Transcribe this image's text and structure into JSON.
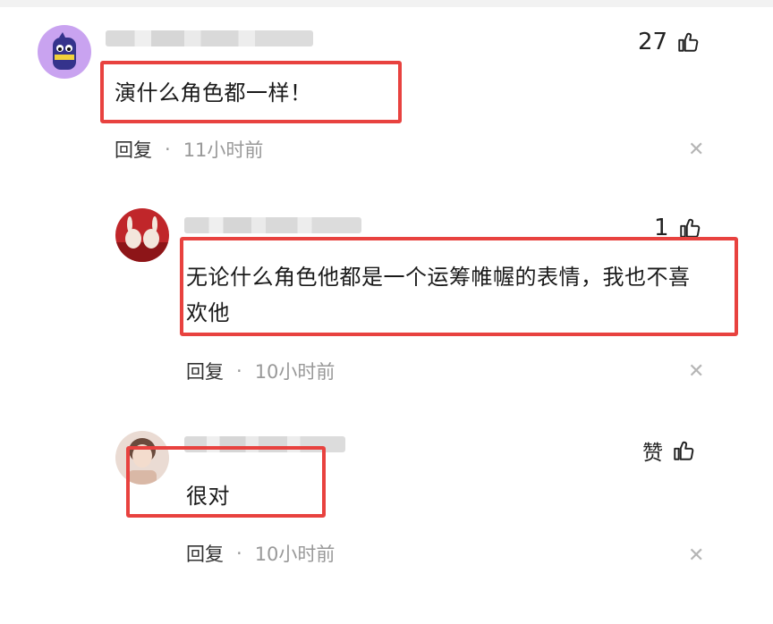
{
  "comments": [
    {
      "likes": "27",
      "text": "演什么角色都一样！",
      "reply_label": "回复",
      "separator": "·",
      "time": "11小时前"
    },
    {
      "likes": "1",
      "text": "无论什么角色他都是一个运筹帷幄的表情，我也不喜欢他",
      "reply_label": "回复",
      "separator": "·",
      "time": "10小时前"
    },
    {
      "likes": "赞",
      "text": "很对",
      "reply_label": "回复",
      "separator": "·",
      "time": "10小时前"
    }
  ],
  "colors": {
    "highlight": "#e8423f",
    "avatar1": "#c9a3f0",
    "avatar2": "#c0262a"
  },
  "icons": {
    "like": "thumbs-up-icon",
    "close": "close-icon"
  }
}
